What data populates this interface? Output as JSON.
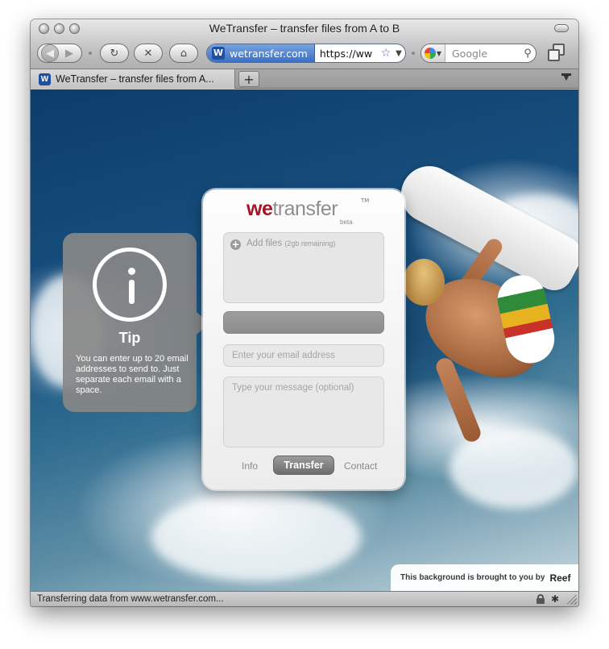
{
  "window": {
    "title": "WeTransfer – transfer files from A to B"
  },
  "toolbar": {
    "back_icon": "back-arrow-icon",
    "forward_icon": "forward-arrow-icon",
    "reload_icon": "reload-icon",
    "stop_icon": "stop-icon",
    "home_icon": "home-icon",
    "url_site_label": "wetransfer.com",
    "url_text": "https://ww",
    "bookmark_icon": "star-icon",
    "search_placeholder": "Google",
    "search_engine_icon": "google-icon",
    "tabs_icon": "tab-overview-icon"
  },
  "tabbar": {
    "tab_label": "WeTransfer – transfer files from A...",
    "new_tab_label": "+"
  },
  "tip": {
    "title": "Tip",
    "text": "You can enter up to 20 email addresses to send to. Just separate each email with a space."
  },
  "panel": {
    "logo_we": "we",
    "logo_rest": "transfer",
    "logo_tm": "TM",
    "logo_beta": "beta",
    "add_files_label": "Add files",
    "add_files_sub": "(2gb remaining)",
    "email_placeholder": "Enter your email address",
    "message_placeholder": "Type your message (optional)",
    "info_label": "Info",
    "transfer_label": "Transfer",
    "contact_label": "Contact",
    "progress": 0
  },
  "credit": {
    "text": "This background is brought to you by",
    "brand": "Reef"
  },
  "status": {
    "text": "Transferring data from www.wetransfer.com..."
  },
  "colors": {
    "brand_red": "#a3142a",
    "ocean_dark": "#0c3d6b",
    "panel_gray": "#878787",
    "safari_blue": "#3a6fc3"
  }
}
